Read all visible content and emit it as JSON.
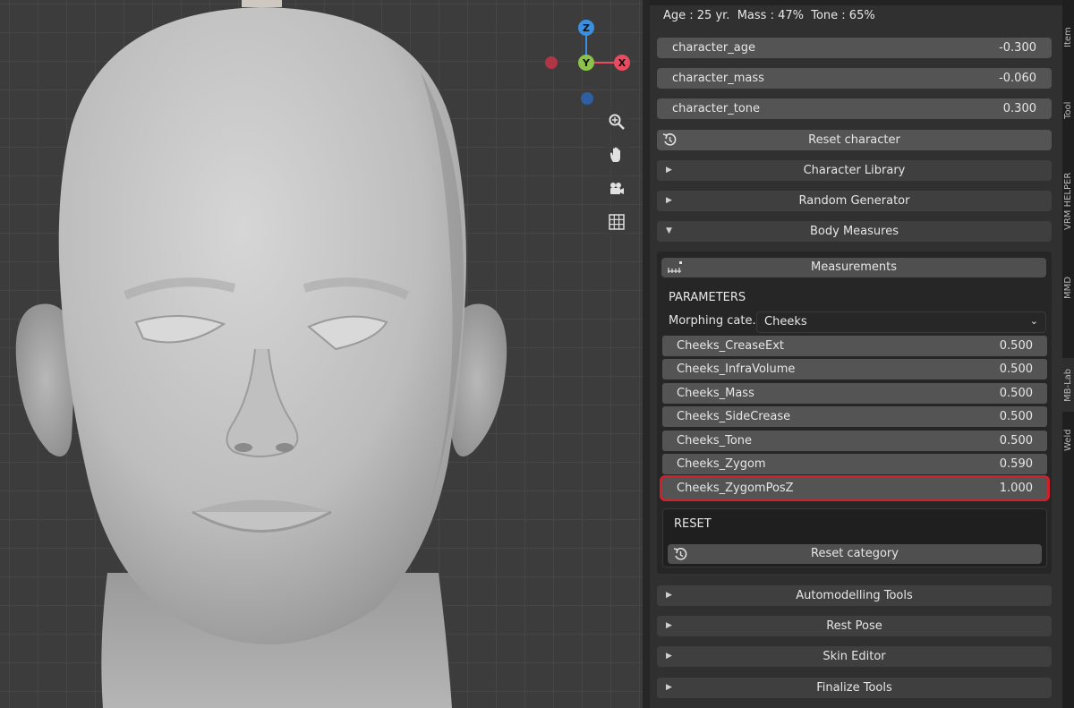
{
  "viewport": {
    "gizmo": {
      "z": "Z",
      "y": "Y",
      "x": "X"
    },
    "nav_icons": [
      "zoom-icon",
      "hand-pan-icon",
      "camera-icon",
      "grid-icon"
    ]
  },
  "status": "Age : 25 yr.  Mass : 47%  Tone : 65%",
  "character_fields": [
    {
      "label": "character_age",
      "value": "-0.300"
    },
    {
      "label": "character_mass",
      "value": "-0.060"
    },
    {
      "label": "character_tone",
      "value": "0.300"
    }
  ],
  "reset_character_label": "Reset character",
  "sections": {
    "character_library": "Character Library",
    "random_generator": "Random Generator",
    "body_measures": "Body Measures",
    "automodelling_tools": "Automodelling Tools",
    "rest_pose": "Rest Pose",
    "skin_editor": "Skin Editor",
    "finalize_tools": "Finalize Tools"
  },
  "body_measures": {
    "measurements_label": "Measurements",
    "parameters_heading": "PARAMETERS",
    "morphing_label": "Morphing cate...",
    "morphing_value": "Cheeks",
    "params": [
      {
        "label": "Cheeks_CreaseExt",
        "value": "0.500"
      },
      {
        "label": "Cheeks_InfraVolume",
        "value": "0.500"
      },
      {
        "label": "Cheeks_Mass",
        "value": "0.500"
      },
      {
        "label": "Cheeks_SideCrease",
        "value": "0.500"
      },
      {
        "label": "Cheeks_Tone",
        "value": "0.500"
      },
      {
        "label": "Cheeks_Zygom",
        "value": "0.590"
      },
      {
        "label": "Cheeks_ZygomPosZ",
        "value": "1.000"
      }
    ],
    "reset_heading": "RESET",
    "reset_category_label": "Reset category"
  },
  "tabs": [
    "Item",
    "Tool",
    "VRM HELPER",
    "MMD",
    "MB-Lab",
    "Weld"
  ],
  "colors": {
    "highlight": "#d0202a",
    "gizmo_x": "#e84a5f",
    "gizmo_y": "#8bc34a",
    "gizmo_z": "#3b8fe0"
  }
}
